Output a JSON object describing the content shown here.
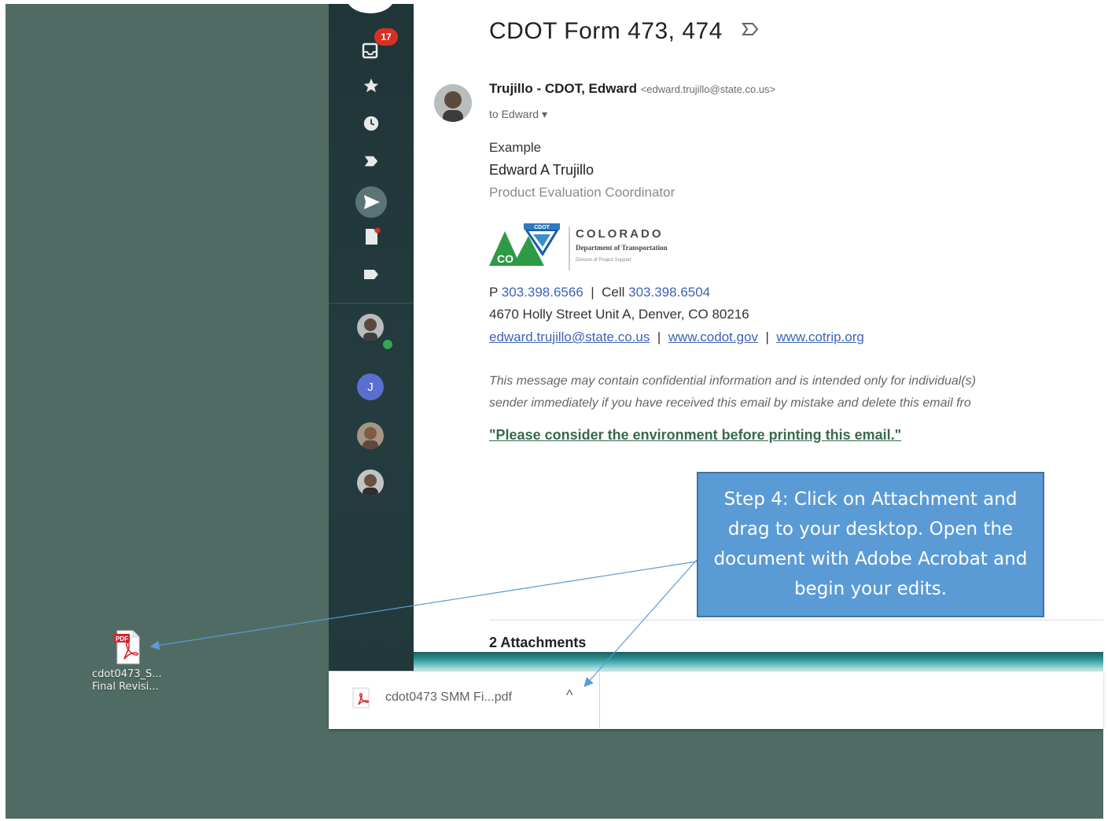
{
  "desktop": {
    "icon_label_line1": "cdot0473_S...",
    "icon_label_line2": "Final Revisi..."
  },
  "rail": {
    "badge_count": "17",
    "avatar_initial": "J"
  },
  "email": {
    "subject": "CDOT Form 473, 474",
    "sender_name": "Trujillo - CDOT, Edward",
    "sender_email": "<edward.trujillo@state.co.us>",
    "to_line": "to Edward",
    "body_first": "Example",
    "sig_name": "Edward A Trujillo",
    "sig_title": "Product Evaluation Coordinator",
    "logo": {
      "badge_text": "CDOT",
      "co_text": "CO",
      "org": "COLORADO",
      "dept": "Department of Transportation",
      "division": "Division of Project Support"
    },
    "phone_prefix": "P",
    "phone": "303.398.6566",
    "sep1": "|",
    "cell_prefix": "Cell",
    "cell": "303.398.6504",
    "address": "4670 Holly Street Unit A, Denver, CO 80216",
    "email_link": "edward.trujillo@state.co.us",
    "sep2": "|",
    "site1": "www.codot.gov",
    "sep3": "|",
    "site2": "www.cotrip.org",
    "disclaimer_line1": "This message may contain confidential information and is intended only for individual(s)",
    "disclaimer_line2": "sender immediately if you have received this email by mistake and delete this email fro",
    "env_note": "\"Please consider the environment before printing this email.\"",
    "attachments_label": "2 Attachments"
  },
  "download_bar": {
    "file_name": "cdot0473 SMM Fi...pdf",
    "chevron": "^"
  },
  "callout": {
    "text": "Step 4: Click on Attachment and drag to your desktop. Open the document with Adobe Acrobat and begin your edits."
  },
  "colors": {
    "desktop_bg": "#506b63",
    "rail_bg": "#22393c",
    "callout_bg": "#5b9bd5",
    "arrow": "#5b9bd5"
  }
}
